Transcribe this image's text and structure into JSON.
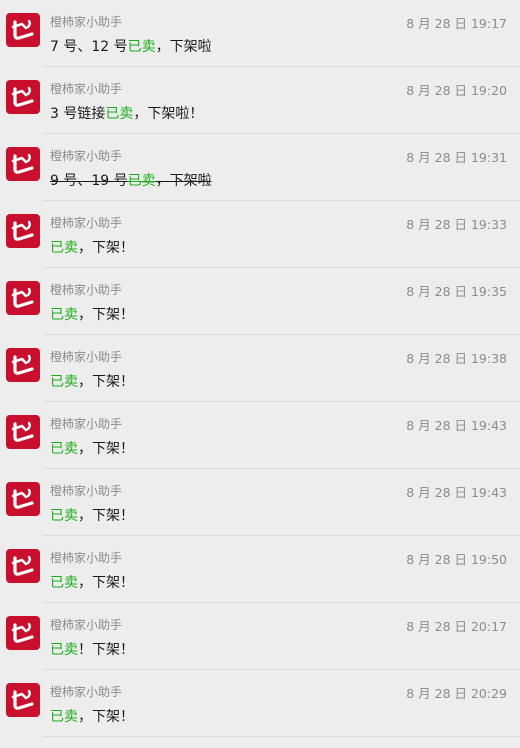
{
  "colors": {
    "background": "#ededed",
    "avatar": "#c8102e",
    "sold_text": "#1aad19",
    "meta_text": "#8c8c8c"
  },
  "messages": [
    {
      "sender": "橙柿家小助手",
      "time": "8 月 28 日 19:17",
      "pre": "7 号、12 号",
      "sold": "已卖",
      "post": "，下架啦",
      "strike": false
    },
    {
      "sender": "橙柿家小助手",
      "time": "8 月 28 日 19:20",
      "pre": "3 号链接",
      "sold": "已卖",
      "post": "，下架啦！",
      "strike": false
    },
    {
      "sender": "橙柿家小助手",
      "time": "8 月 28 日 19:31",
      "pre": "9 号、19 号",
      "sold": "已卖",
      "post": "，下架啦",
      "strike": true
    },
    {
      "sender": "橙柿家小助手",
      "time": "8 月 28 日 19:33",
      "pre": "",
      "sold": "已卖",
      "post": "，下架！",
      "strike": false
    },
    {
      "sender": "橙柿家小助手",
      "time": "8 月 28 日 19:35",
      "pre": "",
      "sold": "已卖",
      "post": "，下架！",
      "strike": false
    },
    {
      "sender": "橙柿家小助手",
      "time": "8 月 28 日 19:38",
      "pre": "",
      "sold": "已卖",
      "post": "，下架！",
      "strike": false
    },
    {
      "sender": "橙柿家小助手",
      "time": "8 月 28 日 19:43",
      "pre": "",
      "sold": "已卖",
      "post": "，下架！",
      "strike": false
    },
    {
      "sender": "橙柿家小助手",
      "time": "8 月 28 日 19:43",
      "pre": "",
      "sold": "已卖",
      "post": "，下架！",
      "strike": false
    },
    {
      "sender": "橙柿家小助手",
      "time": "8 月 28 日 19:50",
      "pre": "",
      "sold": "已卖",
      "post": "，下架！",
      "strike": false
    },
    {
      "sender": "橙柿家小助手",
      "time": "8 月 28 日 20:17",
      "pre": "",
      "sold": "已卖",
      "post": "！下架！",
      "strike": false
    },
    {
      "sender": "橙柿家小助手",
      "time": "8 月 28 日 20:29",
      "pre": "",
      "sold": "已卖",
      "post": "，下架！",
      "strike": false
    }
  ]
}
